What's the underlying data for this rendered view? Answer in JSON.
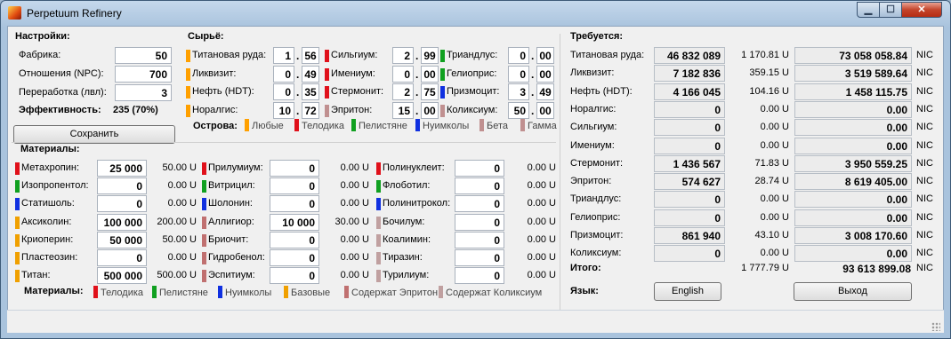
{
  "window": {
    "title": "Perpetuum Refinery"
  },
  "colors": {
    "any": "#ffa000",
    "telodika": "#e0101a",
    "pelistyane": "#10a020",
    "nuimkoly": "#1030e0",
    "beta": "#c09090",
    "gamma": "#c09090",
    "base": "#f0a000",
    "eriton": "#c07070",
    "kolisium": "#c0a0a0"
  },
  "settings": {
    "title": "Настройки:",
    "factory_label": "Фабрика:",
    "factory_value": "50",
    "relation_label": "Отношения (NPC):",
    "relation_value": "700",
    "refine_label": "Переработка (лвл):",
    "refine_value": "3",
    "efficiency_label": "Эффективность:",
    "efficiency_value": "235 (70%)",
    "save_label": "Сохранить"
  },
  "raw": {
    "title": "Сырьё:",
    "items": [
      {
        "label": "Титановая руда:",
        "int": "1",
        "dec": "56",
        "color": "any"
      },
      {
        "label": "Ликвизит:",
        "int": "0",
        "dec": "49",
        "color": "any"
      },
      {
        "label": "Нефть (HDT):",
        "int": "0",
        "dec": "35",
        "color": "any"
      },
      {
        "label": "Норалгис:",
        "int": "10",
        "dec": "72",
        "color": "any"
      },
      {
        "label": "Сильгиум:",
        "int": "2",
        "dec": "99",
        "color": "telodika"
      },
      {
        "label": "Имениум:",
        "int": "0",
        "dec": "00",
        "color": "telodika"
      },
      {
        "label": "Стермонит:",
        "int": "2",
        "dec": "75",
        "color": "telodika"
      },
      {
        "label": "Эпритон:",
        "int": "15",
        "dec": "00",
        "color": "beta"
      },
      {
        "label": "Триандлус:",
        "int": "0",
        "dec": "00",
        "color": "pelistyane"
      },
      {
        "label": "Гелиоприс:",
        "int": "0",
        "dec": "00",
        "color": "pelistyane"
      },
      {
        "label": "Призмоцит:",
        "int": "3",
        "dec": "49",
        "color": "nuimkoly"
      },
      {
        "label": "Коликсиум:",
        "int": "50",
        "dec": "00",
        "color": "gamma"
      }
    ],
    "islands_label": "Острова:",
    "islands": [
      {
        "name": "Любые",
        "color": "any"
      },
      {
        "name": "Телодика",
        "color": "telodika"
      },
      {
        "name": "Пелистяне",
        "color": "pelistyane"
      },
      {
        "name": "Нуимколы",
        "color": "nuimkoly"
      },
      {
        "name": "Бета",
        "color": "beta"
      },
      {
        "name": "Гамма",
        "color": "gamma"
      }
    ]
  },
  "materials": {
    "title": "Материалы:",
    "items": [
      {
        "label": "Метахропин:",
        "value": "25 000",
        "price": "50.00 U",
        "color": "telodika"
      },
      {
        "label": "Изопропентол:",
        "value": "0",
        "price": "0.00 U",
        "color": "pelistyane"
      },
      {
        "label": "Статишоль:",
        "value": "0",
        "price": "0.00 U",
        "color": "nuimkoly"
      },
      {
        "label": "Аксиколин:",
        "value": "100 000",
        "price": "200.00 U",
        "color": "base"
      },
      {
        "label": "Криоперин:",
        "value": "50 000",
        "price": "50.00 U",
        "color": "base"
      },
      {
        "label": "Пластеозин:",
        "value": "0",
        "price": "0.00 U",
        "color": "base"
      },
      {
        "label": "Титан:",
        "value": "500 000",
        "price": "500.00 U",
        "color": "base"
      },
      {
        "label": "Прилумиум:",
        "value": "0",
        "price": "0.00 U",
        "color": "telodika"
      },
      {
        "label": "Витрицил:",
        "value": "0",
        "price": "0.00 U",
        "color": "pelistyane"
      },
      {
        "label": "Шолонин:",
        "value": "0",
        "price": "0.00 U",
        "color": "nuimkoly"
      },
      {
        "label": "Аллигиор:",
        "value": "10 000",
        "price": "30.00 U",
        "color": "eriton"
      },
      {
        "label": "Бриочит:",
        "value": "0",
        "price": "0.00 U",
        "color": "eriton"
      },
      {
        "label": "Гидробенол:",
        "value": "0",
        "price": "0.00 U",
        "color": "eriton"
      },
      {
        "label": "Эспитиум:",
        "value": "0",
        "price": "0.00 U",
        "color": "eriton"
      },
      {
        "label": "Полинуклеит:",
        "value": "0",
        "price": "0.00 U",
        "color": "telodika"
      },
      {
        "label": "Флоботил:",
        "value": "0",
        "price": "0.00 U",
        "color": "pelistyane"
      },
      {
        "label": "Полинитрокол:",
        "value": "0",
        "price": "0.00 U",
        "color": "nuimkoly"
      },
      {
        "label": "Бочилум:",
        "value": "0",
        "price": "0.00 U",
        "color": "kolisium"
      },
      {
        "label": "Коалимин:",
        "value": "0",
        "price": "0.00 U",
        "color": "kolisium"
      },
      {
        "label": "Тиразин:",
        "value": "0",
        "price": "0.00 U",
        "color": "kolisium"
      },
      {
        "label": "Турилиум:",
        "value": "0",
        "price": "0.00 U",
        "color": "kolisium"
      }
    ],
    "legend_label": "Материалы:",
    "legend": [
      {
        "name": "Телодика",
        "color": "telodika"
      },
      {
        "name": "Пелистяне",
        "color": "pelistyane"
      },
      {
        "name": "Нуимколы",
        "color": "nuimkoly"
      },
      {
        "name": "Базовые",
        "color": "base"
      },
      {
        "name": "Содержат Эпритон",
        "color": "eriton"
      },
      {
        "name": "Содержат Коликсиум",
        "color": "kolisium"
      }
    ]
  },
  "required": {
    "title": "Требуется:",
    "currency": "NIC",
    "items": [
      {
        "label": "Титановая руда:",
        "qty": "46 832 089",
        "units": "1 170.81 U",
        "nic": "73 058 058.84"
      },
      {
        "label": "Ликвизит:",
        "qty": "7 182 836",
        "units": "359.15 U",
        "nic": "3 519 589.64"
      },
      {
        "label": "Нефть (HDT):",
        "qty": "4 166 045",
        "units": "104.16 U",
        "nic": "1 458 115.75"
      },
      {
        "label": "Норалгис:",
        "qty": "0",
        "units": "0.00 U",
        "nic": "0.00"
      },
      {
        "label": "Сильгиум:",
        "qty": "0",
        "units": "0.00 U",
        "nic": "0.00"
      },
      {
        "label": "Имениум:",
        "qty": "0",
        "units": "0.00 U",
        "nic": "0.00"
      },
      {
        "label": "Стермонит:",
        "qty": "1 436 567",
        "units": "71.83 U",
        "nic": "3 950 559.25"
      },
      {
        "label": "Эпритон:",
        "qty": "574 627",
        "units": "28.74 U",
        "nic": "8 619 405.00"
      },
      {
        "label": "Триандлус:",
        "qty": "0",
        "units": "0.00 U",
        "nic": "0.00"
      },
      {
        "label": "Гелиоприс:",
        "qty": "0",
        "units": "0.00 U",
        "nic": "0.00"
      },
      {
        "label": "Призмоцит:",
        "qty": "861 940",
        "units": "43.10 U",
        "nic": "3 008 170.60"
      },
      {
        "label": "Коликсиум:",
        "qty": "0",
        "units": "0.00 U",
        "nic": "0.00"
      }
    ],
    "total_label": "Итого:",
    "total_units": "1 777.79 U",
    "total_nic": "93 613 899.08",
    "language_label": "Язык:",
    "language_button": "English",
    "exit_button": "Выход"
  }
}
